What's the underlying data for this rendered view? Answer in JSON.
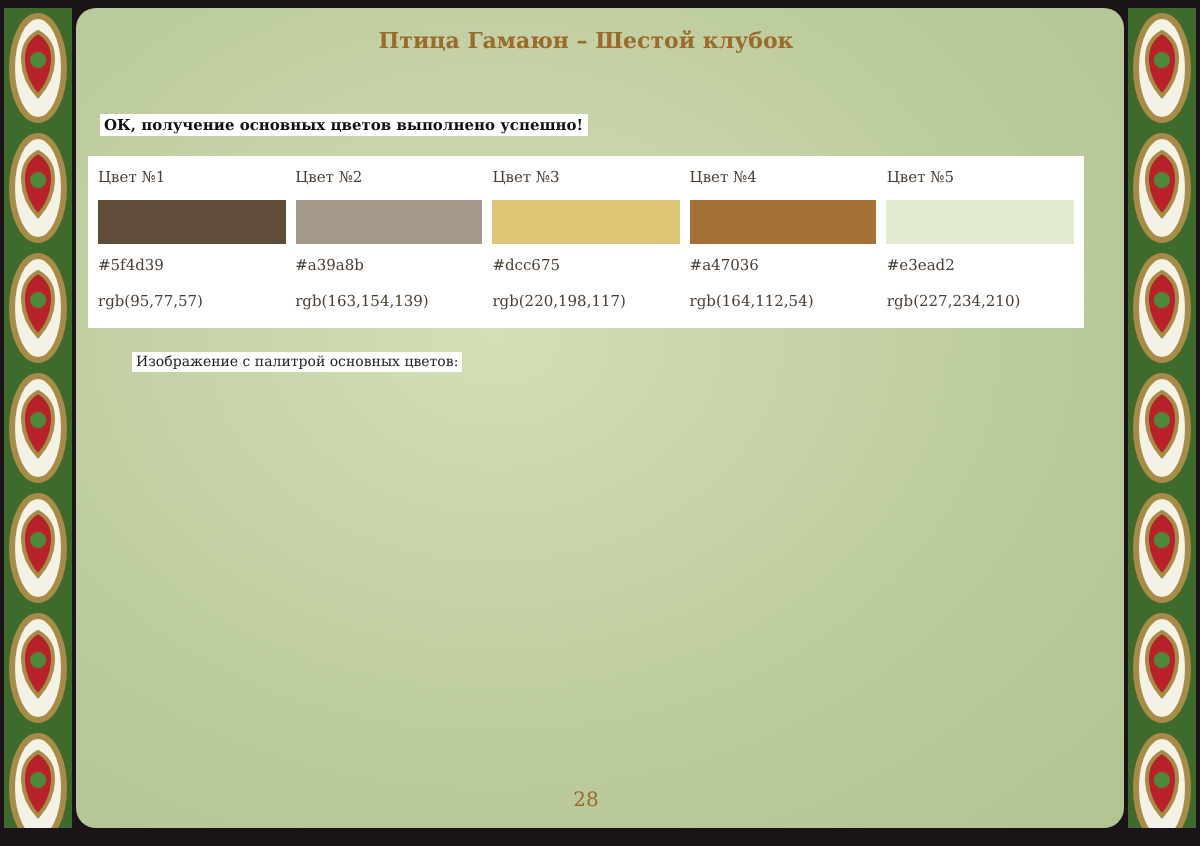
{
  "page": {
    "title": "Птица Гамаюн – Шестой клубок",
    "page_number": "28"
  },
  "message": "ОК, получение основных цветов выполнено успешно!",
  "colors": [
    {
      "label": "Цвет №1",
      "color": "#5f4d39",
      "hex": "#5f4d39",
      "rgb": "rgb(95,77,57)"
    },
    {
      "label": "Цвет №2",
      "color": "#a39a8b",
      "hex": "#a39a8b",
      "rgb": "rgb(163,154,139)"
    },
    {
      "label": "Цвет №3",
      "color": "#dcc675",
      "hex": "#dcc675",
      "rgb": "rgb(220,198,117)"
    },
    {
      "label": "Цвет №4",
      "color": "#a47036",
      "hex": "#a47036",
      "rgb": "rgb(164,112,54)"
    },
    {
      "label": "Цвет №5",
      "color": "#e3ead2",
      "hex": "#e3ead2",
      "rgb": "rgb(227,234,210)"
    }
  ],
  "caption": "Изображение с палитрой основных цветов:"
}
